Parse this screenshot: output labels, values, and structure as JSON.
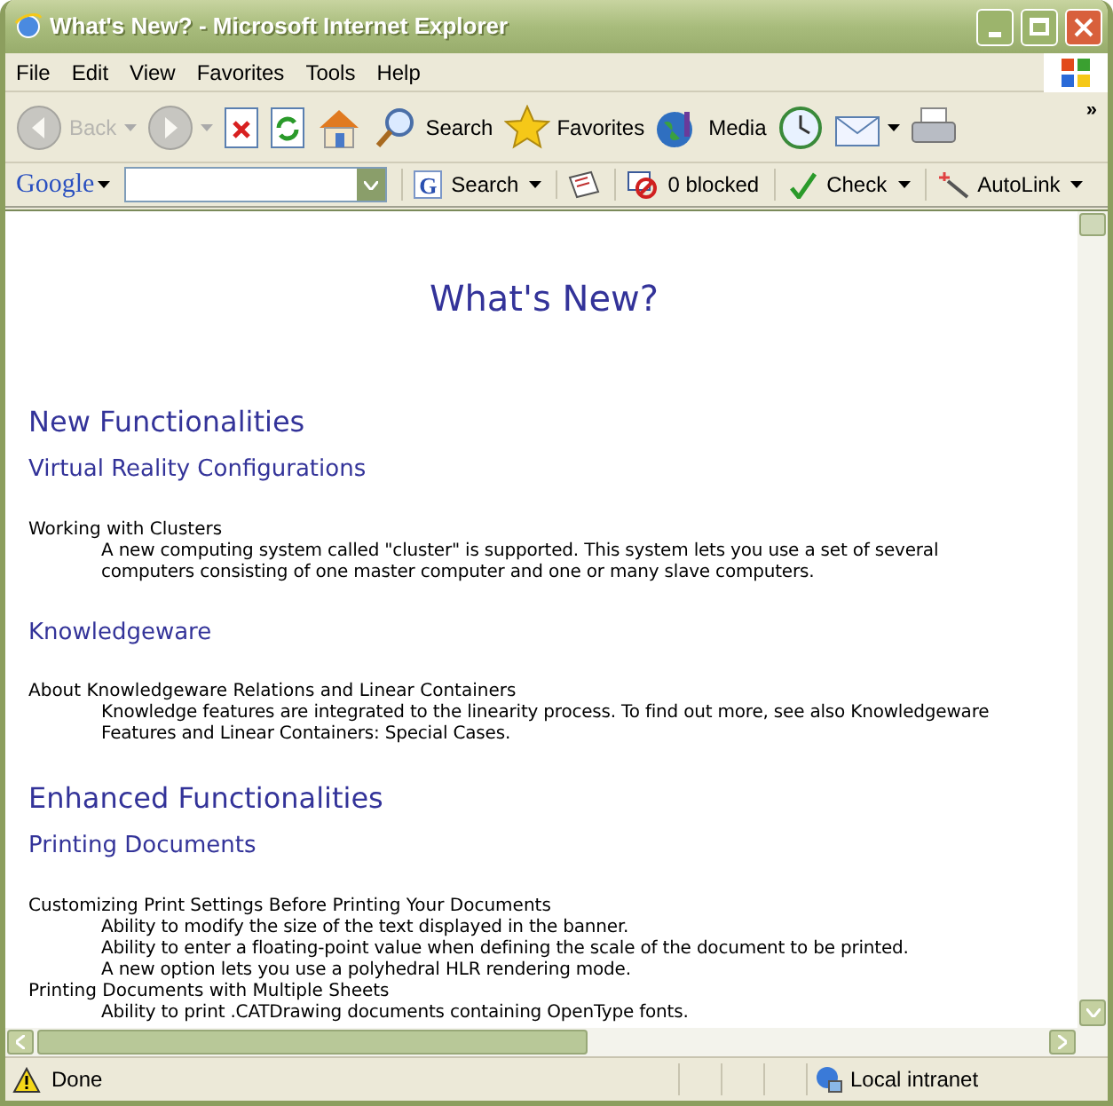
{
  "window": {
    "title": "What's New? - Microsoft Internet Explorer"
  },
  "menu": [
    "File",
    "Edit",
    "View",
    "Favorites",
    "Tools",
    "Help"
  ],
  "toolbar": [
    {
      "kind": "back",
      "label": "Back",
      "disabled": true,
      "dropdown": true
    },
    {
      "kind": "forward",
      "disabled": true,
      "dropdown": true
    },
    {
      "kind": "stop",
      "disabled": false
    },
    {
      "kind": "refresh",
      "disabled": false
    },
    {
      "kind": "home",
      "disabled": false
    },
    {
      "kind": "search",
      "label": "Search",
      "disabled": false
    },
    {
      "kind": "favorites",
      "label": "Favorites",
      "disabled": false
    },
    {
      "kind": "media",
      "label": "Media",
      "disabled": false
    },
    {
      "kind": "history",
      "disabled": false
    },
    {
      "kind": "mail",
      "disabled": false,
      "dropdown": true
    },
    {
      "kind": "print",
      "disabled": false
    }
  ],
  "toolbar_overflow": "»",
  "google_bar": {
    "logo": "Google",
    "items": [
      {
        "kind": "search",
        "icon_text": "G",
        "label": "Search",
        "dropdown": true
      },
      {
        "kind": "news"
      },
      {
        "kind": "blocked",
        "label": "0 blocked"
      },
      {
        "kind": "check",
        "label": "Check",
        "dropdown": true
      },
      {
        "kind": "autolink",
        "label": "AutoLink",
        "dropdown": true
      }
    ]
  },
  "page": {
    "title": "What's New?",
    "sections": [
      {
        "heading": "New Functionalities",
        "subsections": [
          {
            "heading": "Virtual Reality Configurations",
            "entries": [
              {
                "term": "Working with Clusters",
                "lines": [
                  "A new computing system called \"cluster\" is supported. This system lets you use a set of several computers consisting of one master computer and one or many slave computers."
                ]
              }
            ]
          },
          {
            "heading": "Knowledgeware",
            "entries": [
              {
                "term": "About Knowledgeware Relations and Linear Containers",
                "lines": [
                  "Knowledge features are integrated to the linearity process. To find out more, see also Knowledgeware Features and Linear Containers: Special Cases."
                ]
              }
            ]
          }
        ]
      },
      {
        "heading": "Enhanced Functionalities",
        "subsections": [
          {
            "heading": "Printing Documents",
            "entries": [
              {
                "term": "Customizing Print Settings Before Printing Your Documents",
                "lines": [
                  "Ability to modify the size of the text displayed in the banner.",
                  "Ability to enter a floating-point value when defining the scale of the document to be printed.",
                  "A new option lets you use a polyhedral HLR rendering mode."
                ]
              },
              {
                "term": "Printing Documents with Multiple Sheets",
                "lines": [
                  "Ability to print .CATDrawing documents containing OpenType fonts."
                ]
              }
            ]
          }
        ]
      }
    ]
  },
  "status_bar": {
    "text": "Done",
    "zone": "Local intranet"
  }
}
